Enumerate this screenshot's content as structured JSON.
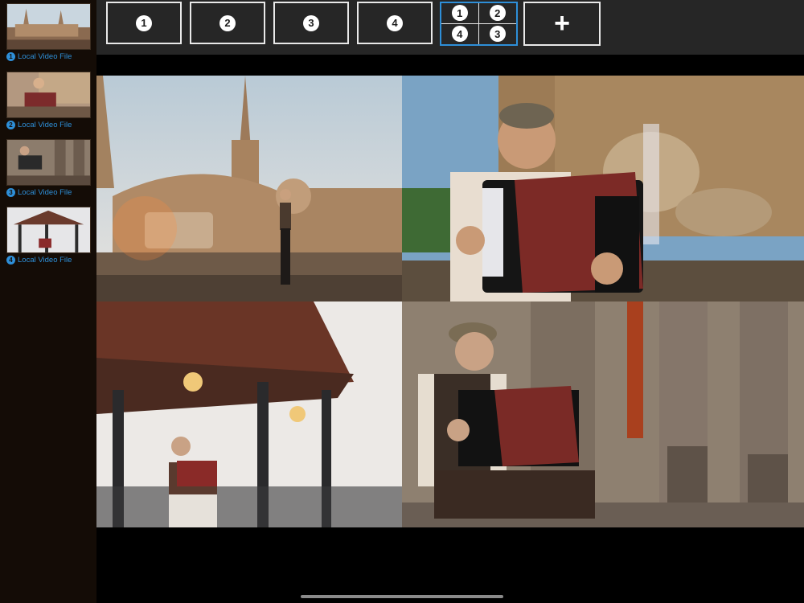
{
  "sources": [
    {
      "number": "1",
      "label": "Local Video File"
    },
    {
      "number": "2",
      "label": "Local Video File"
    },
    {
      "number": "3",
      "label": "Local Video File"
    },
    {
      "number": "4",
      "label": "Local Video File"
    }
  ],
  "camera_buttons": [
    "1",
    "2",
    "3",
    "4"
  ],
  "quad_button": [
    "1",
    "2",
    "4",
    "3"
  ],
  "add_button": "+",
  "colors": {
    "accent": "#2e8fd8",
    "sidebar": "#140c06",
    "topbar": "#262626"
  }
}
